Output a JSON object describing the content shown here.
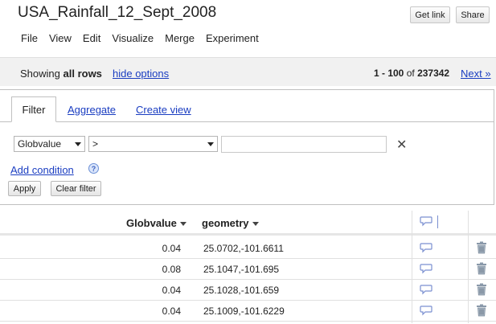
{
  "header": {
    "title": "USA_Rainfall_12_Sept_2008",
    "get_link_label": "Get link",
    "share_label": "Share"
  },
  "menu": [
    "File",
    "View",
    "Edit",
    "Visualize",
    "Merge",
    "Experiment"
  ],
  "options_bar": {
    "showing_prefix": "Showing",
    "showing_bold": "all rows",
    "hide_options": "hide options",
    "range_bold": "1 - 100",
    "range_of": "of",
    "range_total": "237342",
    "next": "Next »"
  },
  "filter_panel": {
    "tabs": [
      "Filter",
      "Aggregate",
      "Create view"
    ],
    "column_select": "Globvalue",
    "operator_select": ">",
    "value_input": "",
    "add_condition": "Add condition",
    "help_glyph": "?",
    "apply_label": "Apply",
    "clear_label": "Clear filter"
  },
  "table": {
    "columns": [
      "Globvalue",
      "geometry"
    ],
    "rows": [
      {
        "globvalue": "0.04",
        "geometry": "25.0702,-101.6611"
      },
      {
        "globvalue": "0.08",
        "geometry": "25.1047,-101.695"
      },
      {
        "globvalue": "0.04",
        "geometry": "25.1028,-101.659"
      },
      {
        "globvalue": "0.04",
        "geometry": "25.1009,-101.6229"
      }
    ]
  },
  "colors": {
    "link": "#1a3dc1",
    "options_bar_bg": "#f1f1f1",
    "comment_icon": "#7a8fd0",
    "trash_icon": "#8a99aa"
  }
}
